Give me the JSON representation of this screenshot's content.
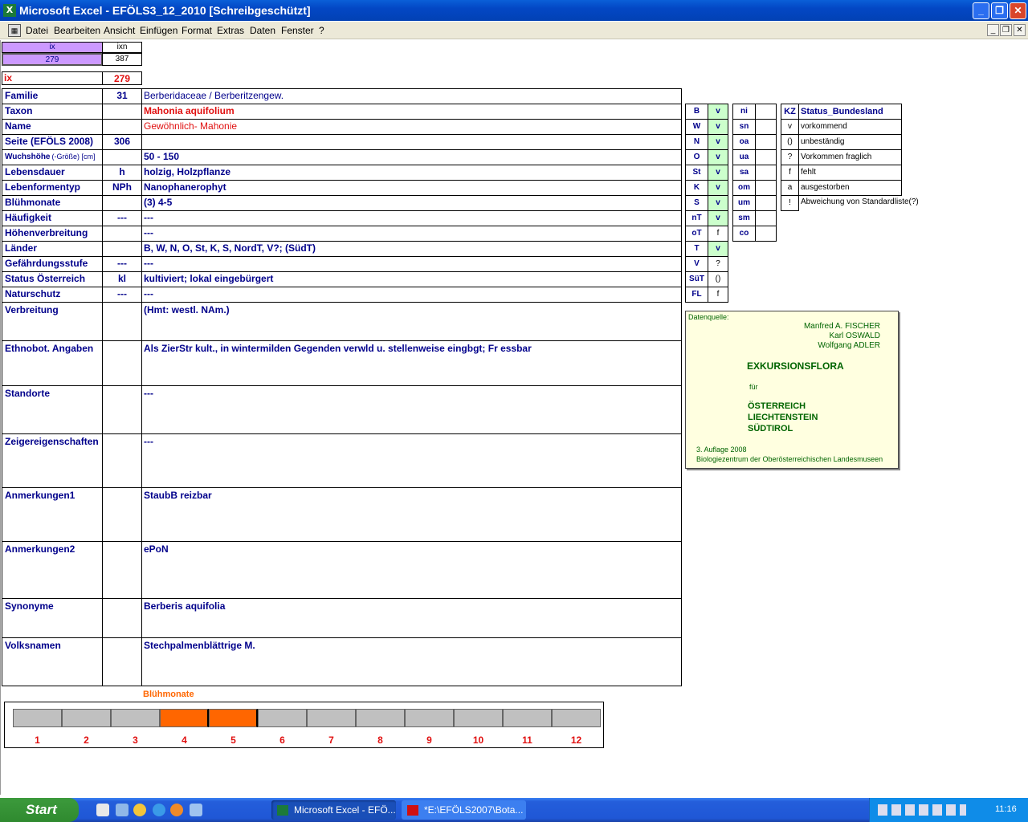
{
  "window": {
    "title": "Microsoft Excel - EFÖLS3_12_2010  [Schreibgeschützt]"
  },
  "menu": [
    "Datei",
    "Bearbeiten",
    "Ansicht",
    "Einfügen",
    "Format",
    "Extras",
    "Daten",
    "Fenster",
    "?"
  ],
  "top": {
    "ix_header": "ix",
    "ixn_header": "ixn",
    "ix_value": "279",
    "ixn_value": "387",
    "ix_label": "ix",
    "ix_big": "279"
  },
  "rows": [
    {
      "label": "Familie",
      "mid": "31",
      "value": "Berberidaceae  /  Berberitzengew."
    },
    {
      "label": "Taxon",
      "mid": "",
      "value": "Mahonia aquifolium"
    },
    {
      "label": "Name",
      "mid": "",
      "value": "Gewöhnlich- Mahonie"
    },
    {
      "label": "Seite (EFÖLS 2008)",
      "mid": "306",
      "value": ""
    },
    {
      "label": "Wuchshöhe",
      "label_suffix": "(-Größe) [cm]",
      "mid": "",
      "value": " 50 - 150"
    },
    {
      "label": "Lebensdauer",
      "mid": "h",
      "value": "holzig, Holzpflanze"
    },
    {
      "label": "Lebenformentyp",
      "mid": "NPh",
      "value": "Nanophanerophyt"
    },
    {
      "label": "Blühmonate",
      "mid": "",
      "value": "(3) 4-5"
    },
    {
      "label": "Häufigkeit",
      "mid": "---",
      "value": " ---"
    },
    {
      "label": "Höhenverbreitung",
      "mid": "",
      "value": " ---"
    },
    {
      "label": "Länder",
      "mid": "",
      "value": "B, W, N, O, St, K, S, NordT, V?; (SüdT)"
    },
    {
      "label": "Gefährdungsstufe",
      "mid": "---",
      "value": "   ---"
    },
    {
      "label": "Status Österreich",
      "mid": "kl",
      "value": "kultiviert; lokal eingebürgert"
    },
    {
      "label": "Naturschutz",
      "mid": "---",
      "value": " ---"
    },
    {
      "label": "Verbreitung",
      "mid": "",
      "value": "(Hmt: westl. NAm.)"
    },
    {
      "label": "Ethnobot. Angaben",
      "mid": "",
      "value": "Als ZierStr kult., in wintermilden Gegenden verwld u. stellenweise eingbgt; Fr essbar"
    },
    {
      "label": "Standorte",
      "mid": "",
      "value": "---"
    },
    {
      "label": "Zeigereigenschaften",
      "mid": "",
      "value": "---"
    },
    {
      "label": "Anmerkungen1",
      "mid": "",
      "value": "StaubB reizbar"
    },
    {
      "label": "Anmerkungen2",
      "mid": "",
      "value": "ePoN"
    },
    {
      "label": "Synonyme",
      "mid": "",
      "value": "Berberis aquifolia"
    },
    {
      "label": "Volksnamen",
      "mid": "",
      "value": "Stechpalmenblättrige M."
    }
  ],
  "laender": [
    {
      "code": "B",
      "status": "v"
    },
    {
      "code": "W",
      "status": "v"
    },
    {
      "code": "N",
      "status": "v"
    },
    {
      "code": "O",
      "status": "v"
    },
    {
      "code": "St",
      "status": "v"
    },
    {
      "code": "K",
      "status": "v"
    },
    {
      "code": "S",
      "status": "v"
    },
    {
      "code": "nT",
      "status": "v"
    },
    {
      "code": "oT",
      "status": "f"
    },
    {
      "code": "T",
      "status": "v"
    },
    {
      "code": "V",
      "status": "?"
    },
    {
      "code": "SüT",
      "status": "()"
    },
    {
      "code": "FL",
      "status": "f"
    }
  ],
  "regions": [
    "ni",
    "sn",
    "oa",
    "ua",
    "sa",
    "om",
    "um",
    "sm",
    "co"
  ],
  "legend": {
    "header_kz": "KZ",
    "header_status": "Status_Bundesland",
    "items": [
      {
        "kz": "v",
        "text": "vorkommend"
      },
      {
        "kz": "()",
        "text": "unbeständig"
      },
      {
        "kz": "?",
        "text": "Vorkommen fraglich"
      },
      {
        "kz": "f",
        "text": "fehlt"
      },
      {
        "kz": "a",
        "text": "ausgestorben"
      },
      {
        "kz": "!",
        "text": "Abweichung von Standardliste(?)"
      }
    ]
  },
  "source": {
    "label": "Datenquelle:",
    "authors": [
      "Manfred A. FISCHER",
      "Karl OSWALD",
      "Wolfgang ADLER"
    ],
    "title": "EXKURSIONSFLORA",
    "fuer": "für",
    "countries": [
      "ÖSTERREICH",
      "LIECHTENSTEIN",
      "SÜDTIROL"
    ],
    "edition": "3. Auflage 2008",
    "publisher": "Biologiezentrum der Oberösterreichischen Landesmuseen"
  },
  "chart_data": {
    "type": "bar",
    "title": "Blühmonate",
    "categories": [
      "1",
      "2",
      "3",
      "4",
      "5",
      "6",
      "7",
      "8",
      "9",
      "10",
      "11",
      "12"
    ],
    "values": [
      0,
      0,
      0,
      1,
      1,
      0,
      0,
      0,
      0,
      0,
      0,
      0
    ],
    "colors": {
      "active": "#ff6600",
      "inactive": "#c0c0c0"
    }
  },
  "taskbar": {
    "start": "Start",
    "tasks": [
      "Microsoft Excel - EFÖ...",
      "*E:\\EFÖLS2007\\Bota..."
    ],
    "clock": "11:16"
  }
}
